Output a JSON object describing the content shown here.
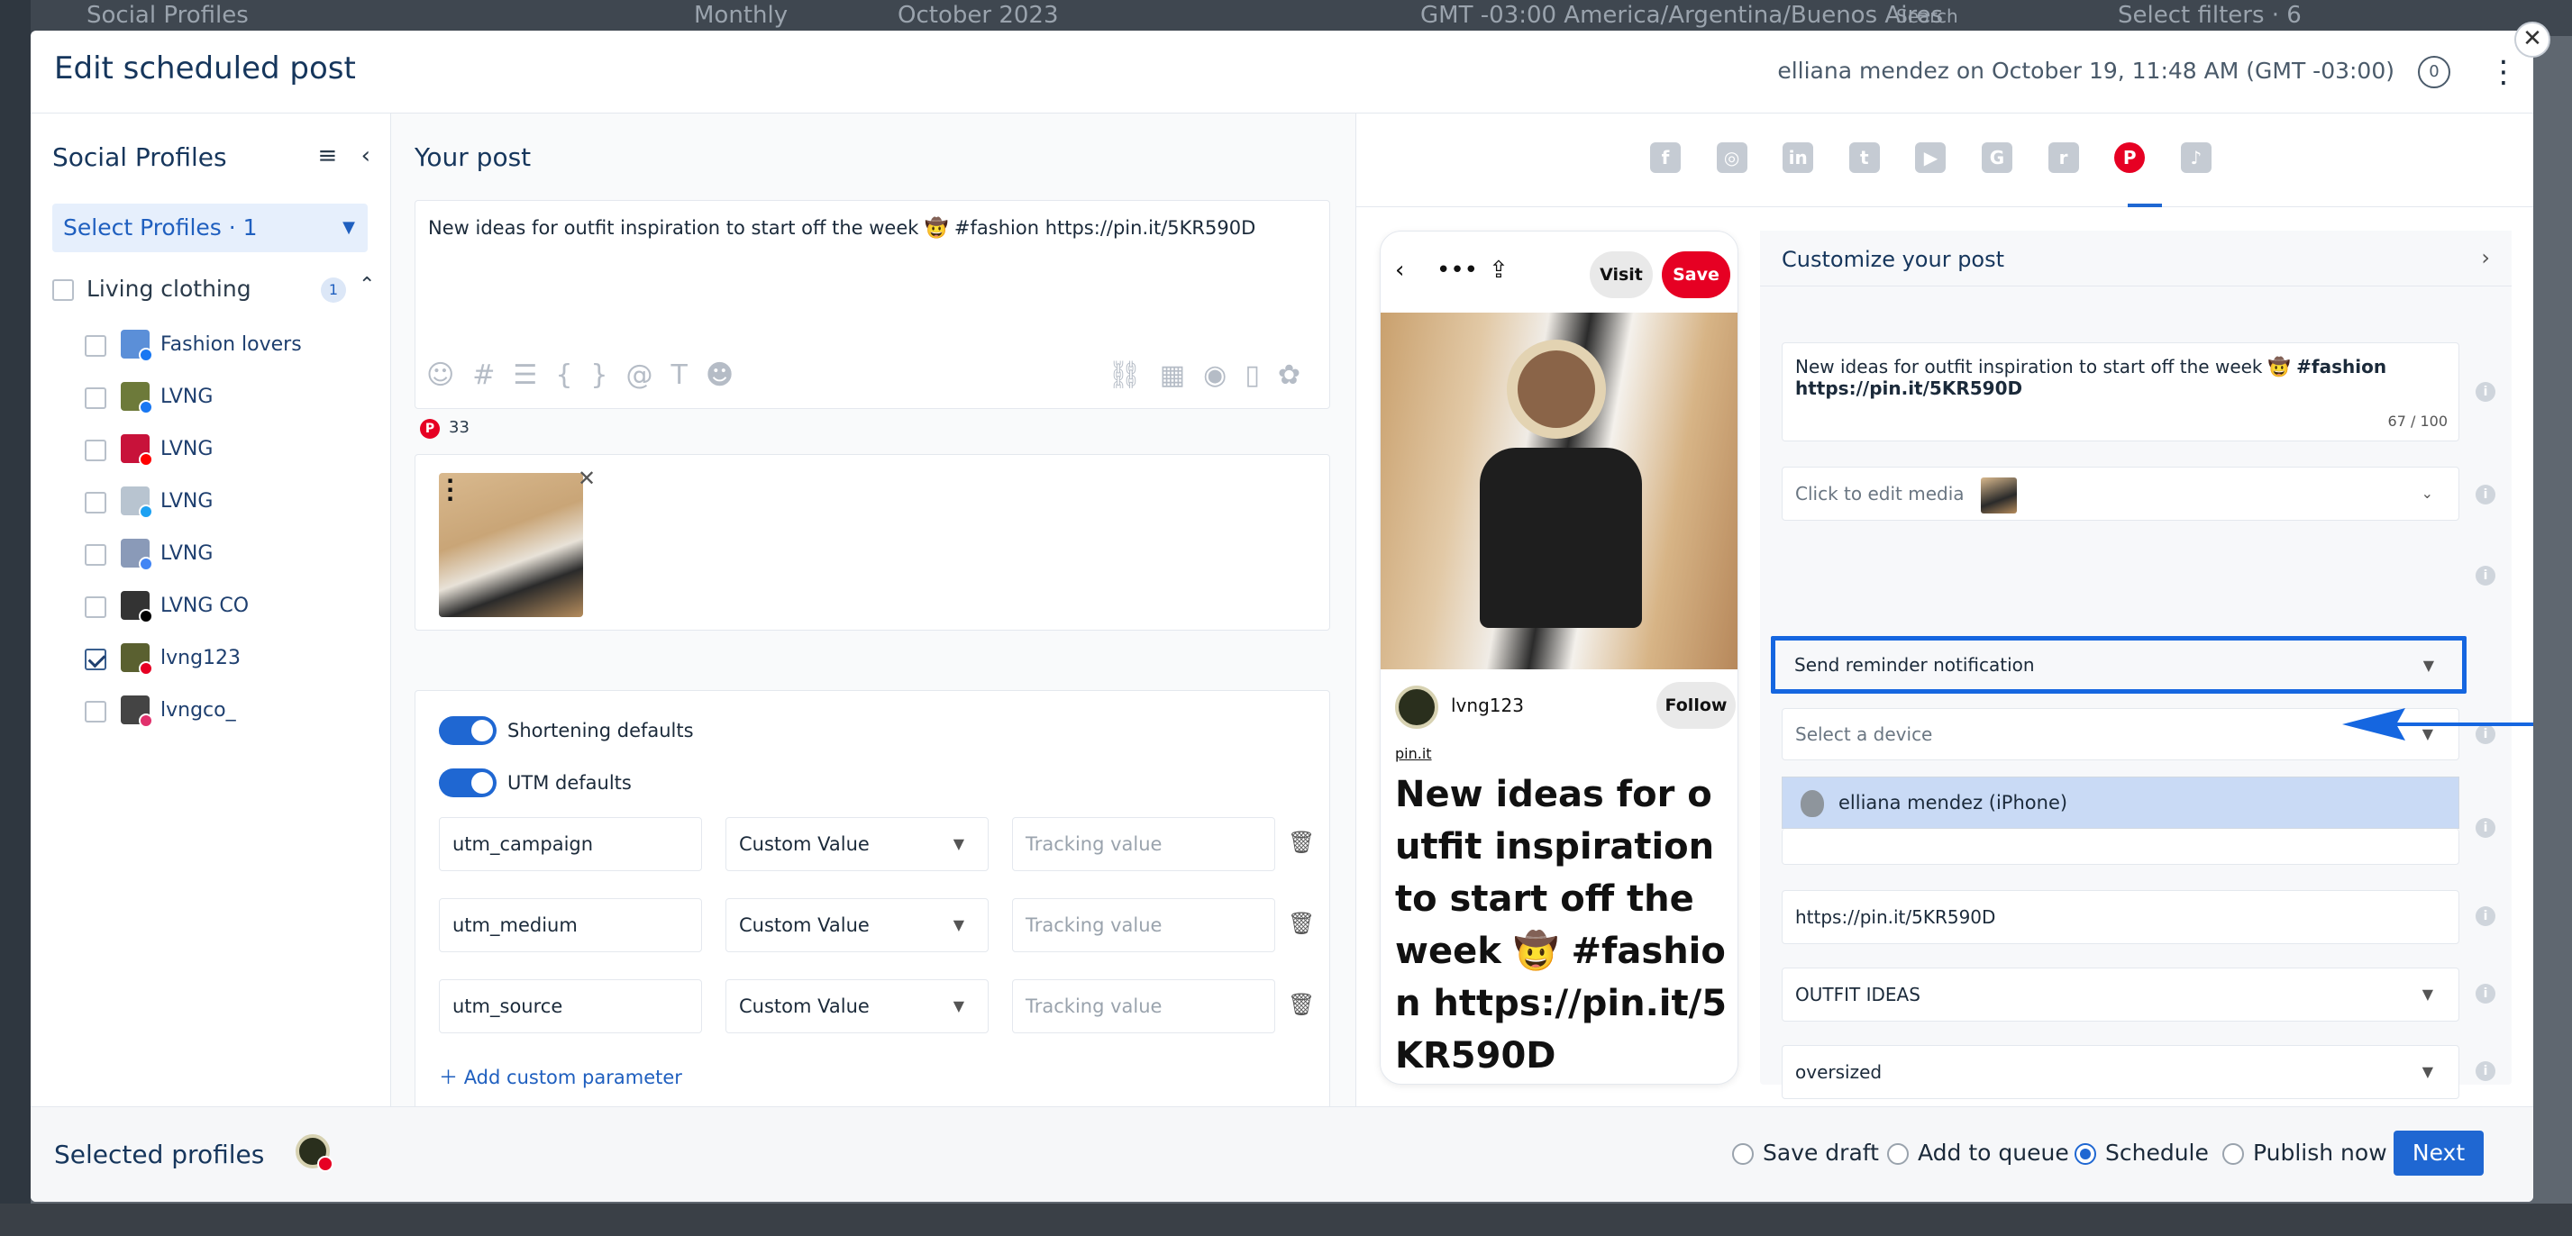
{
  "background": {
    "title": "Social Profiles",
    "view": "Monthly",
    "month": "October 2023",
    "timezone": "GMT -03:00 America/Argentina/Buenos Aires",
    "search": "Search",
    "filters": "Select filters · 6"
  },
  "modal": {
    "title": "Edit scheduled post",
    "meta": "elliana mendez on October 19, 11:48 AM (GMT -03:00)",
    "comment_count": "0"
  },
  "profiles": {
    "heading": "Social Profiles",
    "select_label": "Select Profiles · 1",
    "group": {
      "name": "Living clothing",
      "count": "1"
    },
    "items": [
      {
        "name": "Fashion lovers",
        "checked": false,
        "color": "#5b8fd8",
        "network_color": "#1877f2"
      },
      {
        "name": "LVNG",
        "checked": false,
        "color": "#6d7a3a",
        "network_color": "#1877f2"
      },
      {
        "name": "LVNG",
        "checked": false,
        "color": "#c8123a",
        "network_color": "#ff0000"
      },
      {
        "name": "LVNG",
        "checked": false,
        "color": "#b8c4d0",
        "network_color": "#1da1f2"
      },
      {
        "name": "LVNG",
        "checked": false,
        "color": "#8a9ab8",
        "network_color": "#4285f4"
      },
      {
        "name": "LVNG CO",
        "checked": false,
        "color": "#333333",
        "network_color": "#000000"
      },
      {
        "name": "lvng123",
        "checked": true,
        "color": "#5a6030",
        "network_color": "#e60023"
      },
      {
        "name": "lvngco_",
        "checked": false,
        "color": "#444444",
        "network_color": "#e1306c"
      }
    ]
  },
  "post": {
    "heading": "Your post",
    "text": "New ideas for outfit inspiration to start off the week 🤠 #fashion  https://pin.it/5KR590D",
    "pin_count": "33",
    "shortening_label": "Shortening defaults",
    "utm_label": "UTM defaults",
    "utm_rows": [
      {
        "key": "utm_campaign",
        "select": "Custom Value",
        "placeholder": "Tracking value"
      },
      {
        "key": "utm_medium",
        "select": "Custom Value",
        "placeholder": "Tracking value"
      },
      {
        "key": "utm_source",
        "select": "Custom Value",
        "placeholder": "Tracking value"
      }
    ],
    "add_param": "Add custom parameter"
  },
  "preview": {
    "visit": "Visit",
    "save": "Save",
    "username": "lvng123",
    "follow": "Follow",
    "link": "pin.it",
    "title": "New ideas for outfit inspiration to start off the week 🤠 #fashion https://pin.it/5KR590D"
  },
  "networks": [
    {
      "icon": "facebook-icon",
      "glyph": "f",
      "active": false
    },
    {
      "icon": "instagram-icon",
      "glyph": "◎",
      "active": false
    },
    {
      "icon": "linkedin-icon",
      "glyph": "in",
      "active": false
    },
    {
      "icon": "twitter-icon",
      "glyph": "t",
      "active": false
    },
    {
      "icon": "youtube-icon",
      "glyph": "▶",
      "active": false
    },
    {
      "icon": "google-icon",
      "glyph": "G",
      "active": false
    },
    {
      "icon": "reddit-icon",
      "glyph": "r",
      "active": false
    },
    {
      "icon": "pinterest-icon",
      "glyph": "P",
      "active": true
    },
    {
      "icon": "tiktok-icon",
      "glyph": "♪",
      "active": false
    }
  ],
  "customize": {
    "heading": "Customize your post",
    "description_bold": "#fashion https://pin.it/5KR590D",
    "description_plain": "New ideas for outfit inspiration to start off the week 🤠 ",
    "char_count": "67 / 100",
    "media_label": "Click to edit media",
    "reminder": "Send reminder notification",
    "device_placeholder": "Select a device",
    "device_option": "elliana mendez (iPhone)",
    "link": "https://pin.it/5KR590D",
    "board": "OUTFIT IDEAS",
    "section": "oversized"
  },
  "footer": {
    "selected_label": "Selected profiles",
    "options": [
      {
        "label": "Save draft",
        "selected": false
      },
      {
        "label": "Add to queue",
        "selected": false
      },
      {
        "label": "Schedule",
        "selected": true
      },
      {
        "label": "Publish now",
        "selected": false
      }
    ],
    "next": "Next"
  },
  "colors": {
    "accent": "#1f67d2",
    "pinterest": "#e60023",
    "title": "#16365c"
  }
}
